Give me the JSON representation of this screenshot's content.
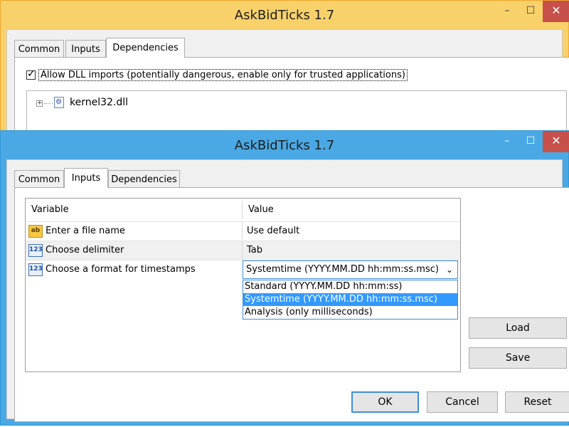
{
  "back_window": {
    "title": "AskBidTicks 1.7",
    "controls": {
      "minimize": "–",
      "maximize": "☐",
      "close": "✕"
    },
    "tabs": [
      {
        "label": "Common"
      },
      {
        "label": "Inputs"
      },
      {
        "label": "Dependencies"
      }
    ],
    "active_tab": "Dependencies",
    "allow_dll": {
      "label": "Allow DLL imports (potentially dangerous, enable only for trusted applications)",
      "checked": true
    },
    "tree": [
      {
        "label": "kernel32.dll",
        "expander": "+",
        "icon": "dll-gear-icon"
      }
    ]
  },
  "front_window": {
    "title": "AskBidTicks 1.7",
    "controls": {
      "minimize": "–",
      "maximize": "☐",
      "close": "✕"
    },
    "tabs": [
      {
        "label": "Common"
      },
      {
        "label": "Inputs"
      },
      {
        "label": "Dependencies"
      }
    ],
    "active_tab": "Inputs",
    "grid": {
      "columns": [
        "Variable",
        "Value"
      ],
      "rows": [
        {
          "icon": "ab",
          "variable": "Enter a file name",
          "value": "Use default"
        },
        {
          "icon": "123",
          "variable": "Choose delimiter",
          "value": "Tab"
        },
        {
          "icon": "123",
          "variable": "Choose a format for timestamps",
          "value": "Systemtime  (YYYY.MM.DD hh:mm:ss.msc)"
        }
      ]
    },
    "combo": {
      "selected": "Systemtime  (YYYY.MM.DD hh:mm:ss.msc)",
      "chevron": "⌄",
      "options": [
        "Standard  (YYYY.MM.DD hh:mm:ss)",
        "Systemtime  (YYYY.MM.DD hh:mm:ss.msc)",
        "Analysis  (only milliseconds)"
      ]
    },
    "side_buttons": {
      "load": "Load",
      "save": "Save"
    },
    "footer_buttons": {
      "ok": "OK",
      "cancel": "Cancel",
      "reset": "Reset"
    }
  },
  "colors": {
    "back_frame": "#f8d16a",
    "front_frame": "#4aa9e4",
    "close_button": "#c7504a",
    "selection": "#3399ff"
  }
}
